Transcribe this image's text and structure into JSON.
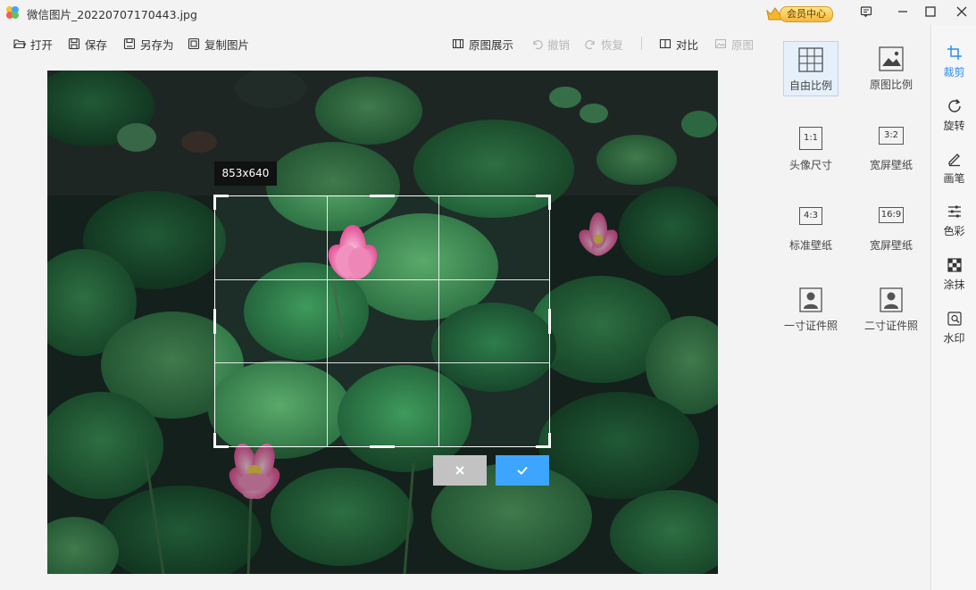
{
  "titlebar": {
    "filename": "微信图片_20220707170443.jpg",
    "vip_label": "会员中心"
  },
  "toolbar": {
    "open": "打开",
    "save": "保存",
    "save_as": "另存为",
    "copy_image": "复制图片",
    "show_original": "原图展示",
    "undo": "撤销",
    "redo": "恢复",
    "compare": "对比",
    "original": "原图"
  },
  "crop": {
    "size_label": "853x640"
  },
  "crop_options": [
    {
      "label": "自由比例",
      "icon": "grid-icon",
      "active": true
    },
    {
      "label": "原图比例",
      "icon": "image-icon"
    },
    {
      "label": "头像尺寸",
      "ratio": "1:1"
    },
    {
      "label": "宽屏壁纸",
      "ratio": "3:2"
    },
    {
      "label": "标准壁纸",
      "ratio": "4:3"
    },
    {
      "label": "宽屏壁纸",
      "ratio": "16:9"
    },
    {
      "label": "一寸证件照",
      "icon": "id-photo-icon"
    },
    {
      "label": "二寸证件照",
      "icon": "id-photo-icon"
    }
  ],
  "sidebar": [
    {
      "label": "裁剪",
      "icon": "crop-icon",
      "active": true
    },
    {
      "label": "旋转",
      "icon": "rotate-icon"
    },
    {
      "label": "画笔",
      "icon": "pen-icon"
    },
    {
      "label": "色彩",
      "icon": "sliders-icon"
    },
    {
      "label": "涂抹",
      "icon": "mosaic-icon"
    },
    {
      "label": "水印",
      "icon": "watermark-icon"
    }
  ],
  "colors": {
    "accent": "#2f8cf0",
    "confirm": "#3ea5ff",
    "cancel": "#c2c2c2"
  }
}
